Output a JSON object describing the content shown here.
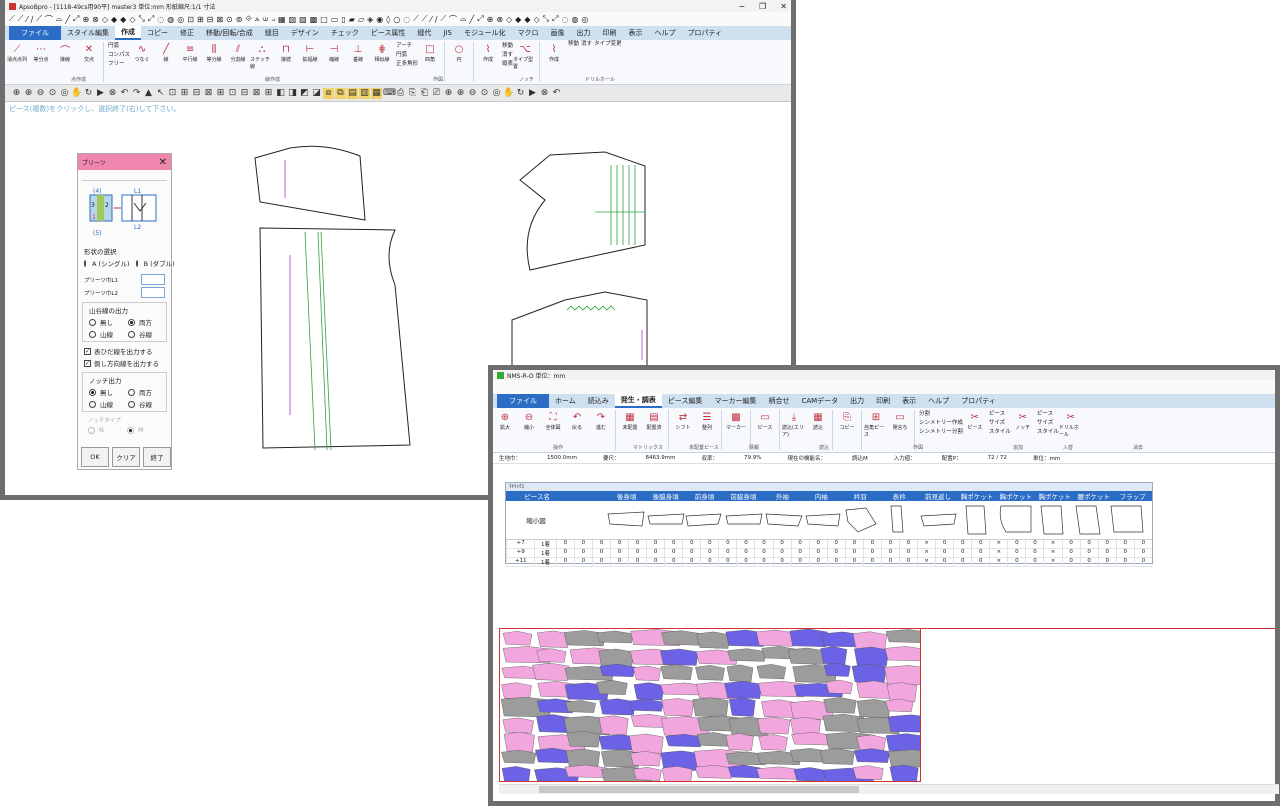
{
  "win1": {
    "title": "ApsoBpro - [1118-49cs用90平]  master3  単位:mm  形紙縮尺:1/1  寸法",
    "tabs": [
      "ファイル",
      "スタイル編集",
      "作成",
      "コピー",
      "修正",
      "移動/回転/合成",
      "縫目",
      "デザイン",
      "チェック",
      "ピース属性",
      "縫代",
      "JIS",
      "モジュール化",
      "マクロ",
      "画像",
      "出力",
      "印刷",
      "表示",
      "ヘルプ",
      "プロパティ"
    ],
    "active_tab": "作成",
    "ribbon_buttons": [
      "消点点列",
      "等分点",
      "接線",
      "交点",
      "つなぐ",
      "線",
      "平行線",
      "等分線",
      "分割線",
      "ステッチ線",
      "接続",
      "拡幅線",
      "縮線",
      "垂線",
      "相似線",
      "四角",
      "円",
      "作成",
      "タイプ型置",
      "作成"
    ],
    "ribbon_small": [
      "円弧",
      "コンパス",
      "フリー",
      "アーチ",
      "円弧",
      "正多角形",
      "移動",
      "消す",
      "縦表",
      "移動",
      "消す",
      "タイプ変更"
    ],
    "group_labels": [
      "点作成",
      "線作成",
      "作図",
      "ノッチ",
      "ドリルホール"
    ],
    "hint": "ピース(複数)をクリックし、選択終了(右)して下さい。"
  },
  "dialog": {
    "title": "プリーツ",
    "shape_label": "形状の選択",
    "opt_a": "A (シングル)",
    "opt_b": "B (ダブル)",
    "l1_label": "プリーツ巾L1",
    "l2_label": "プリーツ巾L2",
    "fold_label": "山谷線の出力",
    "fold_opts": [
      "無し",
      "両方",
      "山線",
      "谷線"
    ],
    "chk1": "表ひだ線を出力する",
    "chk2": "倒し方向線を出力する",
    "notch_label": "ノッチ出力",
    "notch_opts": [
      "無し",
      "両方",
      "山線",
      "谷線"
    ],
    "notch_type_label": "ノッチタイプ",
    "notch_type_opts": [
      "N",
      "M"
    ],
    "buttons": [
      "OK",
      "クリア",
      "終了"
    ],
    "diagram_labels": [
      "(4)",
      "L1",
      "3",
      "2",
      "1",
      "L2",
      "(5)"
    ]
  },
  "win2": {
    "title": "NMS-R-O  単位：mm",
    "tabs": [
      "ファイル",
      "ホーム",
      "読込み",
      "発生・調表",
      "ピース編集",
      "マーカー編集",
      "柄合せ",
      "CAMデータ",
      "出力",
      "印刷",
      "表示",
      "ヘルプ",
      "プロパティ"
    ],
    "active_tab": "発生・調表",
    "ribbon_buttons": [
      "拡大",
      "縮小",
      "全体図",
      "戻る",
      "進む",
      "未配置",
      "配置済",
      "シフト",
      "整列",
      "マーカー",
      "ピース",
      "読込(エリア)",
      "読込",
      "コピー",
      "自角ピース",
      "発言ち",
      "ピース",
      "ノッチ",
      "ドリルホール"
    ],
    "ribbon_small": [
      "分割",
      "シンメトリー作成",
      "シンメトリー分割",
      "ピース",
      "サイズ",
      "スタイル",
      "ピース",
      "サイズ",
      "スタイル"
    ],
    "group_labels": [
      "操作",
      "マトリックス",
      "未配置ピース",
      "情報",
      "読込",
      "作図",
      "追加",
      "入替",
      "消去"
    ],
    "status": [
      "生地巾：",
      "1500.0mm",
      "要尺：",
      "8463.9mm",
      "収率：",
      "79.9%",
      "現在の機能名：",
      "読込M",
      "入力値：",
      "配置P：",
      "72 / 72",
      "単位：mm"
    ]
  },
  "matrix": {
    "title": "ﾏﾄﾘｯｸｽ",
    "headers": [
      "ピース名",
      "",
      "後身頃",
      "後脇身頃",
      "前身頃",
      "前脇身頃",
      "外袖",
      "内袖",
      "衿羽",
      "表衿",
      "前見返し",
      "胸ポケット",
      "胸ポケット",
      "胸ポケット",
      "腰ポケット",
      "フラップ"
    ],
    "shape_row_label": "縮小図",
    "rows": [
      {
        "size": "+7",
        "n": "1着",
        "vals": [
          "0",
          "0",
          "0",
          "0",
          "0",
          "0",
          "0",
          "0",
          "0",
          "0",
          "0",
          "0",
          "0",
          "0",
          "0",
          "0",
          "0",
          "0",
          "0",
          "0",
          "×",
          "0",
          "0",
          "0",
          "×",
          "0",
          "0",
          "×",
          "0",
          "0",
          "0",
          "0",
          "0"
        ]
      },
      {
        "size": "+9",
        "n": "1着",
        "vals": [
          "0",
          "0",
          "0",
          "0",
          "0",
          "0",
          "0",
          "0",
          "0",
          "0",
          "0",
          "0",
          "0",
          "0",
          "0",
          "0",
          "0",
          "0",
          "0",
          "0",
          "×",
          "0",
          "0",
          "0",
          "×",
          "0",
          "0",
          "×",
          "0",
          "0",
          "0",
          "0",
          "0"
        ]
      },
      {
        "size": "+11",
        "n": "1着",
        "vals": [
          "0",
          "0",
          "0",
          "0",
          "0",
          "0",
          "0",
          "0",
          "0",
          "0",
          "0",
          "0",
          "0",
          "0",
          "0",
          "0",
          "0",
          "0",
          "0",
          "0",
          "×",
          "0",
          "0",
          "0",
          "×",
          "0",
          "0",
          "×",
          "0",
          "0",
          "0",
          "0",
          "0"
        ]
      }
    ]
  },
  "colors": {
    "pink": "#f1a7de",
    "blue": "#6b62e6",
    "gray": "#9c9c9c",
    "file_tab": "#2b6cc4",
    "dialog_title": "#ef86ad"
  }
}
